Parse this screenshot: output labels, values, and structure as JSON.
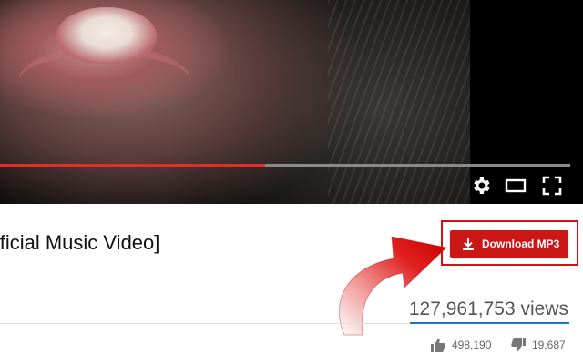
{
  "video": {
    "progress_fraction": 0.465,
    "controls": {
      "settings_icon": "gear-icon",
      "theater_icon": "theater-mode-icon",
      "fullscreen_icon": "fullscreen-icon"
    }
  },
  "title": "fficial Music Video]",
  "download": {
    "label": "Download MP3",
    "icon": "download-icon",
    "color": "#cc1717"
  },
  "views": "127,961,753 views",
  "likes": {
    "count": "498,190",
    "icon": "thumbs-up-icon"
  },
  "dislikes": {
    "count": "19,687",
    "icon": "thumbs-down-icon"
  },
  "colors": {
    "progress": "#e52d27",
    "views_bar": "#167ac6",
    "callout_border": "#d90f0f"
  }
}
